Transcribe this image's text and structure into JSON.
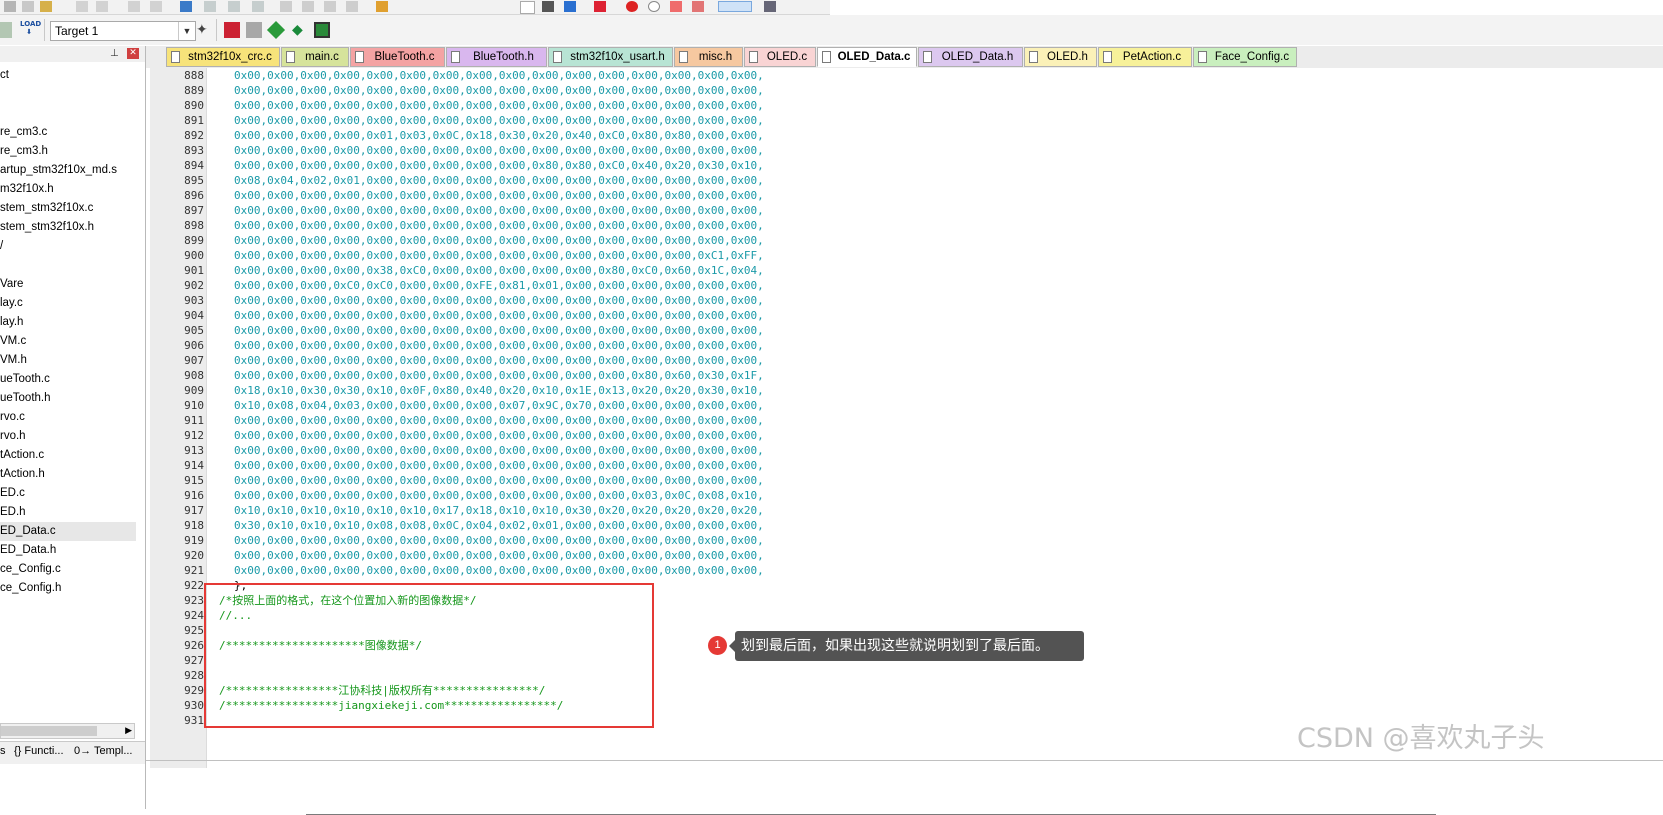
{
  "toolbar": {
    "load_label": "LOAD",
    "target": "Target 1"
  },
  "project_panel": {
    "items": [
      {
        "label": "ct"
      },
      {
        "label": ""
      },
      {
        "label": ""
      },
      {
        "label": "re_cm3.c"
      },
      {
        "label": "re_cm3.h"
      },
      {
        "label": "artup_stm32f10x_md.s"
      },
      {
        "label": "m32f10x.h"
      },
      {
        "label": "stem_stm32f10x.c"
      },
      {
        "label": "stem_stm32f10x.h"
      },
      {
        "label": "/"
      },
      {
        "label": ""
      },
      {
        "label": "Vare"
      },
      {
        "label": "lay.c"
      },
      {
        "label": "lay.h"
      },
      {
        "label": "VM.c"
      },
      {
        "label": "VM.h"
      },
      {
        "label": "ueTooth.c"
      },
      {
        "label": "ueTooth.h"
      },
      {
        "label": "rvo.c"
      },
      {
        "label": "rvo.h"
      },
      {
        "label": "tAction.c"
      },
      {
        "label": "tAction.h"
      },
      {
        "label": "ED.c"
      },
      {
        "label": "ED.h"
      },
      {
        "label": "ED_Data.c",
        "selected": true
      },
      {
        "label": "ED_Data.h"
      },
      {
        "label": "ce_Config.c"
      },
      {
        "label": "ce_Config.h"
      }
    ],
    "bottom_tabs": [
      "s",
      "{} Functi...",
      "0→ Templ..."
    ]
  },
  "tabs": [
    {
      "label": "stm32f10x_crc.c",
      "color": "#f7e37a"
    },
    {
      "label": "main.c",
      "color": "#d6e39b"
    },
    {
      "label": "BlueTooth.c",
      "color": "#f4a3a3"
    },
    {
      "label": "BlueTooth.h",
      "color": "#d9b7ee"
    },
    {
      "label": "stm32f10x_usart.h",
      "color": "#b8e4d4"
    },
    {
      "label": "misc.h",
      "color": "#f6c8a0"
    },
    {
      "label": "OLED.c",
      "color": "#f9d4d4"
    },
    {
      "label": "OLED_Data.c",
      "color": "#ffffff",
      "active": true
    },
    {
      "label": "OLED_Data.h",
      "color": "#dcc8ef"
    },
    {
      "label": "OLED.h",
      "color": "#fbf1b8"
    },
    {
      "label": "PetAction.c",
      "color": "#f7f19a"
    },
    {
      "label": "Face_Config.c",
      "color": "#c9efbe"
    }
  ],
  "editor": {
    "lines": [
      {
        "n": "888",
        "text": "0x00,0x00,0x00,0x00,0x00,0x00,0x00,0x00,0x00,0x00,0x00,0x00,0x00,0x00,0x00,0x00,"
      },
      {
        "n": "889",
        "text": "0x00,0x00,0x00,0x00,0x00,0x00,0x00,0x00,0x00,0x00,0x00,0x00,0x00,0x00,0x00,0x00,"
      },
      {
        "n": "890",
        "text": "0x00,0x00,0x00,0x00,0x00,0x00,0x00,0x00,0x00,0x00,0x00,0x00,0x00,0x00,0x00,0x00,"
      },
      {
        "n": "891",
        "text": "0x00,0x00,0x00,0x00,0x00,0x00,0x00,0x00,0x00,0x00,0x00,0x00,0x00,0x00,0x00,0x00,"
      },
      {
        "n": "892",
        "text": "0x00,0x00,0x00,0x00,0x01,0x03,0x0C,0x18,0x30,0x20,0x40,0xC0,0x80,0x80,0x00,0x00,"
      },
      {
        "n": "893",
        "text": "0x00,0x00,0x00,0x00,0x00,0x00,0x00,0x00,0x00,0x00,0x00,0x00,0x00,0x00,0x00,0x00,"
      },
      {
        "n": "894",
        "text": "0x00,0x00,0x00,0x00,0x00,0x00,0x00,0x00,0x00,0x80,0x80,0xC0,0x40,0x20,0x30,0x10,"
      },
      {
        "n": "895",
        "text": "0x08,0x04,0x02,0x01,0x00,0x00,0x00,0x00,0x00,0x00,0x00,0x00,0x00,0x00,0x00,0x00,"
      },
      {
        "n": "896",
        "text": "0x00,0x00,0x00,0x00,0x00,0x00,0x00,0x00,0x00,0x00,0x00,0x00,0x00,0x00,0x00,0x00,"
      },
      {
        "n": "897",
        "text": "0x00,0x00,0x00,0x00,0x00,0x00,0x00,0x00,0x00,0x00,0x00,0x00,0x00,0x00,0x00,0x00,"
      },
      {
        "n": "898",
        "text": "0x00,0x00,0x00,0x00,0x00,0x00,0x00,0x00,0x00,0x00,0x00,0x00,0x00,0x00,0x00,0x00,"
      },
      {
        "n": "899",
        "text": "0x00,0x00,0x00,0x00,0x00,0x00,0x00,0x00,0x00,0x00,0x00,0x00,0x00,0x00,0x00,0x00,"
      },
      {
        "n": "900",
        "text": "0x00,0x00,0x00,0x00,0x00,0x00,0x00,0x00,0x00,0x00,0x00,0x00,0x00,0x00,0xC1,0xFF,"
      },
      {
        "n": "901",
        "text": "0x00,0x00,0x00,0x00,0x38,0xC0,0x00,0x00,0x00,0x00,0x00,0x80,0xC0,0x60,0x1C,0x04,"
      },
      {
        "n": "902",
        "text": "0x00,0x00,0x00,0xC0,0xC0,0x00,0x00,0xFE,0x81,0x01,0x00,0x00,0x00,0x00,0x00,0x00,"
      },
      {
        "n": "903",
        "text": "0x00,0x00,0x00,0x00,0x00,0x00,0x00,0x00,0x00,0x00,0x00,0x00,0x00,0x00,0x00,0x00,"
      },
      {
        "n": "904",
        "text": "0x00,0x00,0x00,0x00,0x00,0x00,0x00,0x00,0x00,0x00,0x00,0x00,0x00,0x00,0x00,0x00,"
      },
      {
        "n": "905",
        "text": "0x00,0x00,0x00,0x00,0x00,0x00,0x00,0x00,0x00,0x00,0x00,0x00,0x00,0x00,0x00,0x00,"
      },
      {
        "n": "906",
        "text": "0x00,0x00,0x00,0x00,0x00,0x00,0x00,0x00,0x00,0x00,0x00,0x00,0x00,0x00,0x00,0x00,"
      },
      {
        "n": "907",
        "text": "0x00,0x00,0x00,0x00,0x00,0x00,0x00,0x00,0x00,0x00,0x00,0x00,0x00,0x00,0x00,0x00,"
      },
      {
        "n": "908",
        "text": "0x00,0x00,0x00,0x00,0x00,0x00,0x00,0x00,0x00,0x00,0x00,0x00,0x80,0x60,0x30,0x1F,"
      },
      {
        "n": "909",
        "text": "0x18,0x10,0x30,0x30,0x10,0x0F,0x80,0x40,0x20,0x10,0x1E,0x13,0x20,0x20,0x30,0x10,"
      },
      {
        "n": "910",
        "text": "0x10,0x08,0x04,0x03,0x00,0x00,0x00,0x00,0x07,0x9C,0x70,0x00,0x00,0x00,0x00,0x00,"
      },
      {
        "n": "911",
        "text": "0x00,0x00,0x00,0x00,0x00,0x00,0x00,0x00,0x00,0x00,0x00,0x00,0x00,0x00,0x00,0x00,"
      },
      {
        "n": "912",
        "text": "0x00,0x00,0x00,0x00,0x00,0x00,0x00,0x00,0x00,0x00,0x00,0x00,0x00,0x00,0x00,0x00,"
      },
      {
        "n": "913",
        "text": "0x00,0x00,0x00,0x00,0x00,0x00,0x00,0x00,0x00,0x00,0x00,0x00,0x00,0x00,0x00,0x00,"
      },
      {
        "n": "914",
        "text": "0x00,0x00,0x00,0x00,0x00,0x00,0x00,0x00,0x00,0x00,0x00,0x00,0x00,0x00,0x00,0x00,"
      },
      {
        "n": "915",
        "text": "0x00,0x00,0x00,0x00,0x00,0x00,0x00,0x00,0x00,0x00,0x00,0x00,0x00,0x00,0x00,0x00,"
      },
      {
        "n": "916",
        "text": "0x00,0x00,0x00,0x00,0x00,0x00,0x00,0x00,0x00,0x00,0x00,0x00,0x03,0x0C,0x08,0x10,"
      },
      {
        "n": "917",
        "text": "0x10,0x10,0x10,0x10,0x10,0x10,0x17,0x18,0x10,0x10,0x30,0x20,0x20,0x20,0x20,0x20,"
      },
      {
        "n": "918",
        "text": "0x30,0x10,0x10,0x10,0x08,0x08,0x0C,0x04,0x02,0x01,0x00,0x00,0x00,0x00,0x00,0x00,"
      },
      {
        "n": "919",
        "text": "0x00,0x00,0x00,0x00,0x00,0x00,0x00,0x00,0x00,0x00,0x00,0x00,0x00,0x00,0x00,0x00,"
      },
      {
        "n": "920",
        "text": "0x00,0x00,0x00,0x00,0x00,0x00,0x00,0x00,0x00,0x00,0x00,0x00,0x00,0x00,0x00,0x00,"
      },
      {
        "n": "921",
        "text": "0x00,0x00,0x00,0x00,0x00,0x00,0x00,0x00,0x00,0x00,0x00,0x00,0x00,0x00,0x00,0x00,"
      },
      {
        "n": "922",
        "text": "};",
        "kind": "brace"
      },
      {
        "n": "923",
        "text": "/*按照上面的格式，在这个位置加入新的图像数据*/",
        "kind": "cmt"
      },
      {
        "n": "924",
        "text": "//...",
        "kind": "cmt"
      },
      {
        "n": "925",
        "text": "",
        "kind": "cmt"
      },
      {
        "n": "926",
        "text": "/*********************图像数据*/",
        "kind": "cmt"
      },
      {
        "n": "927",
        "text": "",
        "kind": "cmt"
      },
      {
        "n": "928",
        "text": "",
        "kind": "cmt"
      },
      {
        "n": "929",
        "text": "/*****************江协科技|版权所有****************/",
        "kind": "cmt"
      },
      {
        "n": "930",
        "text": "/*****************jiangxiekeji.com*****************/",
        "kind": "cmt"
      },
      {
        "n": "931",
        "text": "",
        "kind": "cmt"
      }
    ]
  },
  "annotation": {
    "number": "1",
    "text": "划到最后面，如果出现这些就说明划到了最后面。"
  },
  "watermark": "CSDN @喜欢丸子头",
  "colors": {
    "hex_literal": "#1a9aa8",
    "comment": "#16971c",
    "highlight": "#e53935",
    "callout_bg": "#535353"
  }
}
